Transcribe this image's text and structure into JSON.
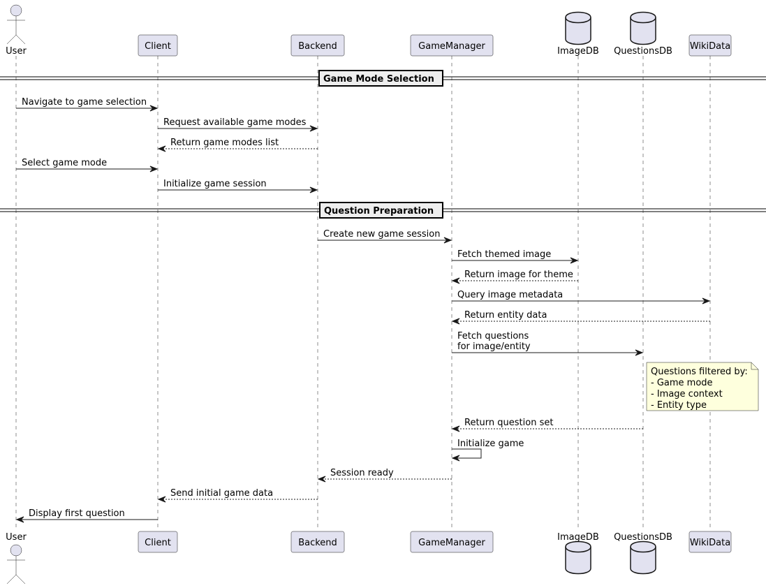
{
  "participants": [
    {
      "id": "user",
      "label": "User",
      "kind": "actor"
    },
    {
      "id": "client",
      "label": "Client",
      "kind": "participant"
    },
    {
      "id": "backend",
      "label": "Backend",
      "kind": "participant"
    },
    {
      "id": "gm",
      "label": "GameManager",
      "kind": "participant"
    },
    {
      "id": "imagedb",
      "label": "ImageDB",
      "kind": "database"
    },
    {
      "id": "qdb",
      "label": "QuestionsDB",
      "kind": "database"
    },
    {
      "id": "wiki",
      "label": "WikiData",
      "kind": "participant"
    }
  ],
  "dividers": [
    {
      "label": "Game Mode Selection",
      "after": -1
    },
    {
      "label": "Question Preparation",
      "after": 4
    }
  ],
  "messages": [
    {
      "from": "user",
      "to": "client",
      "label": [
        "Navigate to game selection"
      ],
      "style": "solid"
    },
    {
      "from": "client",
      "to": "backend",
      "label": [
        "Request available game modes"
      ],
      "style": "solid"
    },
    {
      "from": "backend",
      "to": "client",
      "label": [
        "Return game modes list"
      ],
      "style": "dashed"
    },
    {
      "from": "user",
      "to": "client",
      "label": [
        "Select game mode"
      ],
      "style": "solid"
    },
    {
      "from": "client",
      "to": "backend",
      "label": [
        "Initialize game session"
      ],
      "style": "solid"
    },
    {
      "from": "backend",
      "to": "gm",
      "label": [
        "Create new game session"
      ],
      "style": "solid"
    },
    {
      "from": "gm",
      "to": "imagedb",
      "label": [
        "Fetch themed image"
      ],
      "style": "solid"
    },
    {
      "from": "imagedb",
      "to": "gm",
      "label": [
        "Return image for theme"
      ],
      "style": "dashed"
    },
    {
      "from": "gm",
      "to": "wiki",
      "label": [
        "Query image metadata"
      ],
      "style": "solid"
    },
    {
      "from": "wiki",
      "to": "gm",
      "label": [
        "Return entity data"
      ],
      "style": "dashed"
    },
    {
      "from": "gm",
      "to": "qdb",
      "label": [
        "Fetch questions",
        "for image/entity"
      ],
      "style": "solid"
    },
    {
      "from": "qdb",
      "to": "gm",
      "label": [
        "Return question set"
      ],
      "style": "dashed"
    },
    {
      "from": "gm",
      "to": "gm",
      "label": [
        "Initialize game"
      ],
      "style": "solid"
    },
    {
      "from": "gm",
      "to": "backend",
      "label": [
        "Session ready"
      ],
      "style": "dashed"
    },
    {
      "from": "backend",
      "to": "client",
      "label": [
        "Send initial game data"
      ],
      "style": "dashed"
    },
    {
      "from": "client",
      "to": "user",
      "label": [
        "Display first question"
      ],
      "style": "solid"
    }
  ],
  "note": {
    "over": "qdb",
    "lines": [
      "Questions filtered by:",
      "- Game mode",
      "- Image context",
      "- Entity type"
    ]
  },
  "colors": {
    "participant_fill": "#E2E2F0",
    "participant_border": "#181818",
    "note_fill": "#FEFFDD",
    "divider_fill": "#EEEEEE"
  }
}
